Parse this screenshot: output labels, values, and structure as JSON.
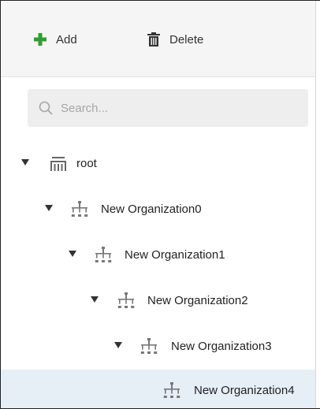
{
  "toolbar": {
    "add_label": "Add",
    "delete_label": "Delete"
  },
  "search": {
    "placeholder": "Search..."
  },
  "tree": {
    "nodes": [
      {
        "label": "root",
        "expanded": true
      },
      {
        "label": "New Organization0",
        "expanded": true
      },
      {
        "label": "New Organization1",
        "expanded": true
      },
      {
        "label": "New Organization2",
        "expanded": true
      },
      {
        "label": "New Organization3",
        "expanded": true
      },
      {
        "label": "New Organization4",
        "selected": true
      }
    ]
  },
  "colors": {
    "add_icon": "#2f9e2f",
    "selected_row": "#e6eef6",
    "toolbar_bg": "#f5f5f5"
  },
  "icons": {
    "add": "plus-icon",
    "delete": "trash-icon",
    "search": "search-icon",
    "root": "building-icon",
    "org": "org-chart-icon",
    "expand": "caret-down-icon"
  }
}
